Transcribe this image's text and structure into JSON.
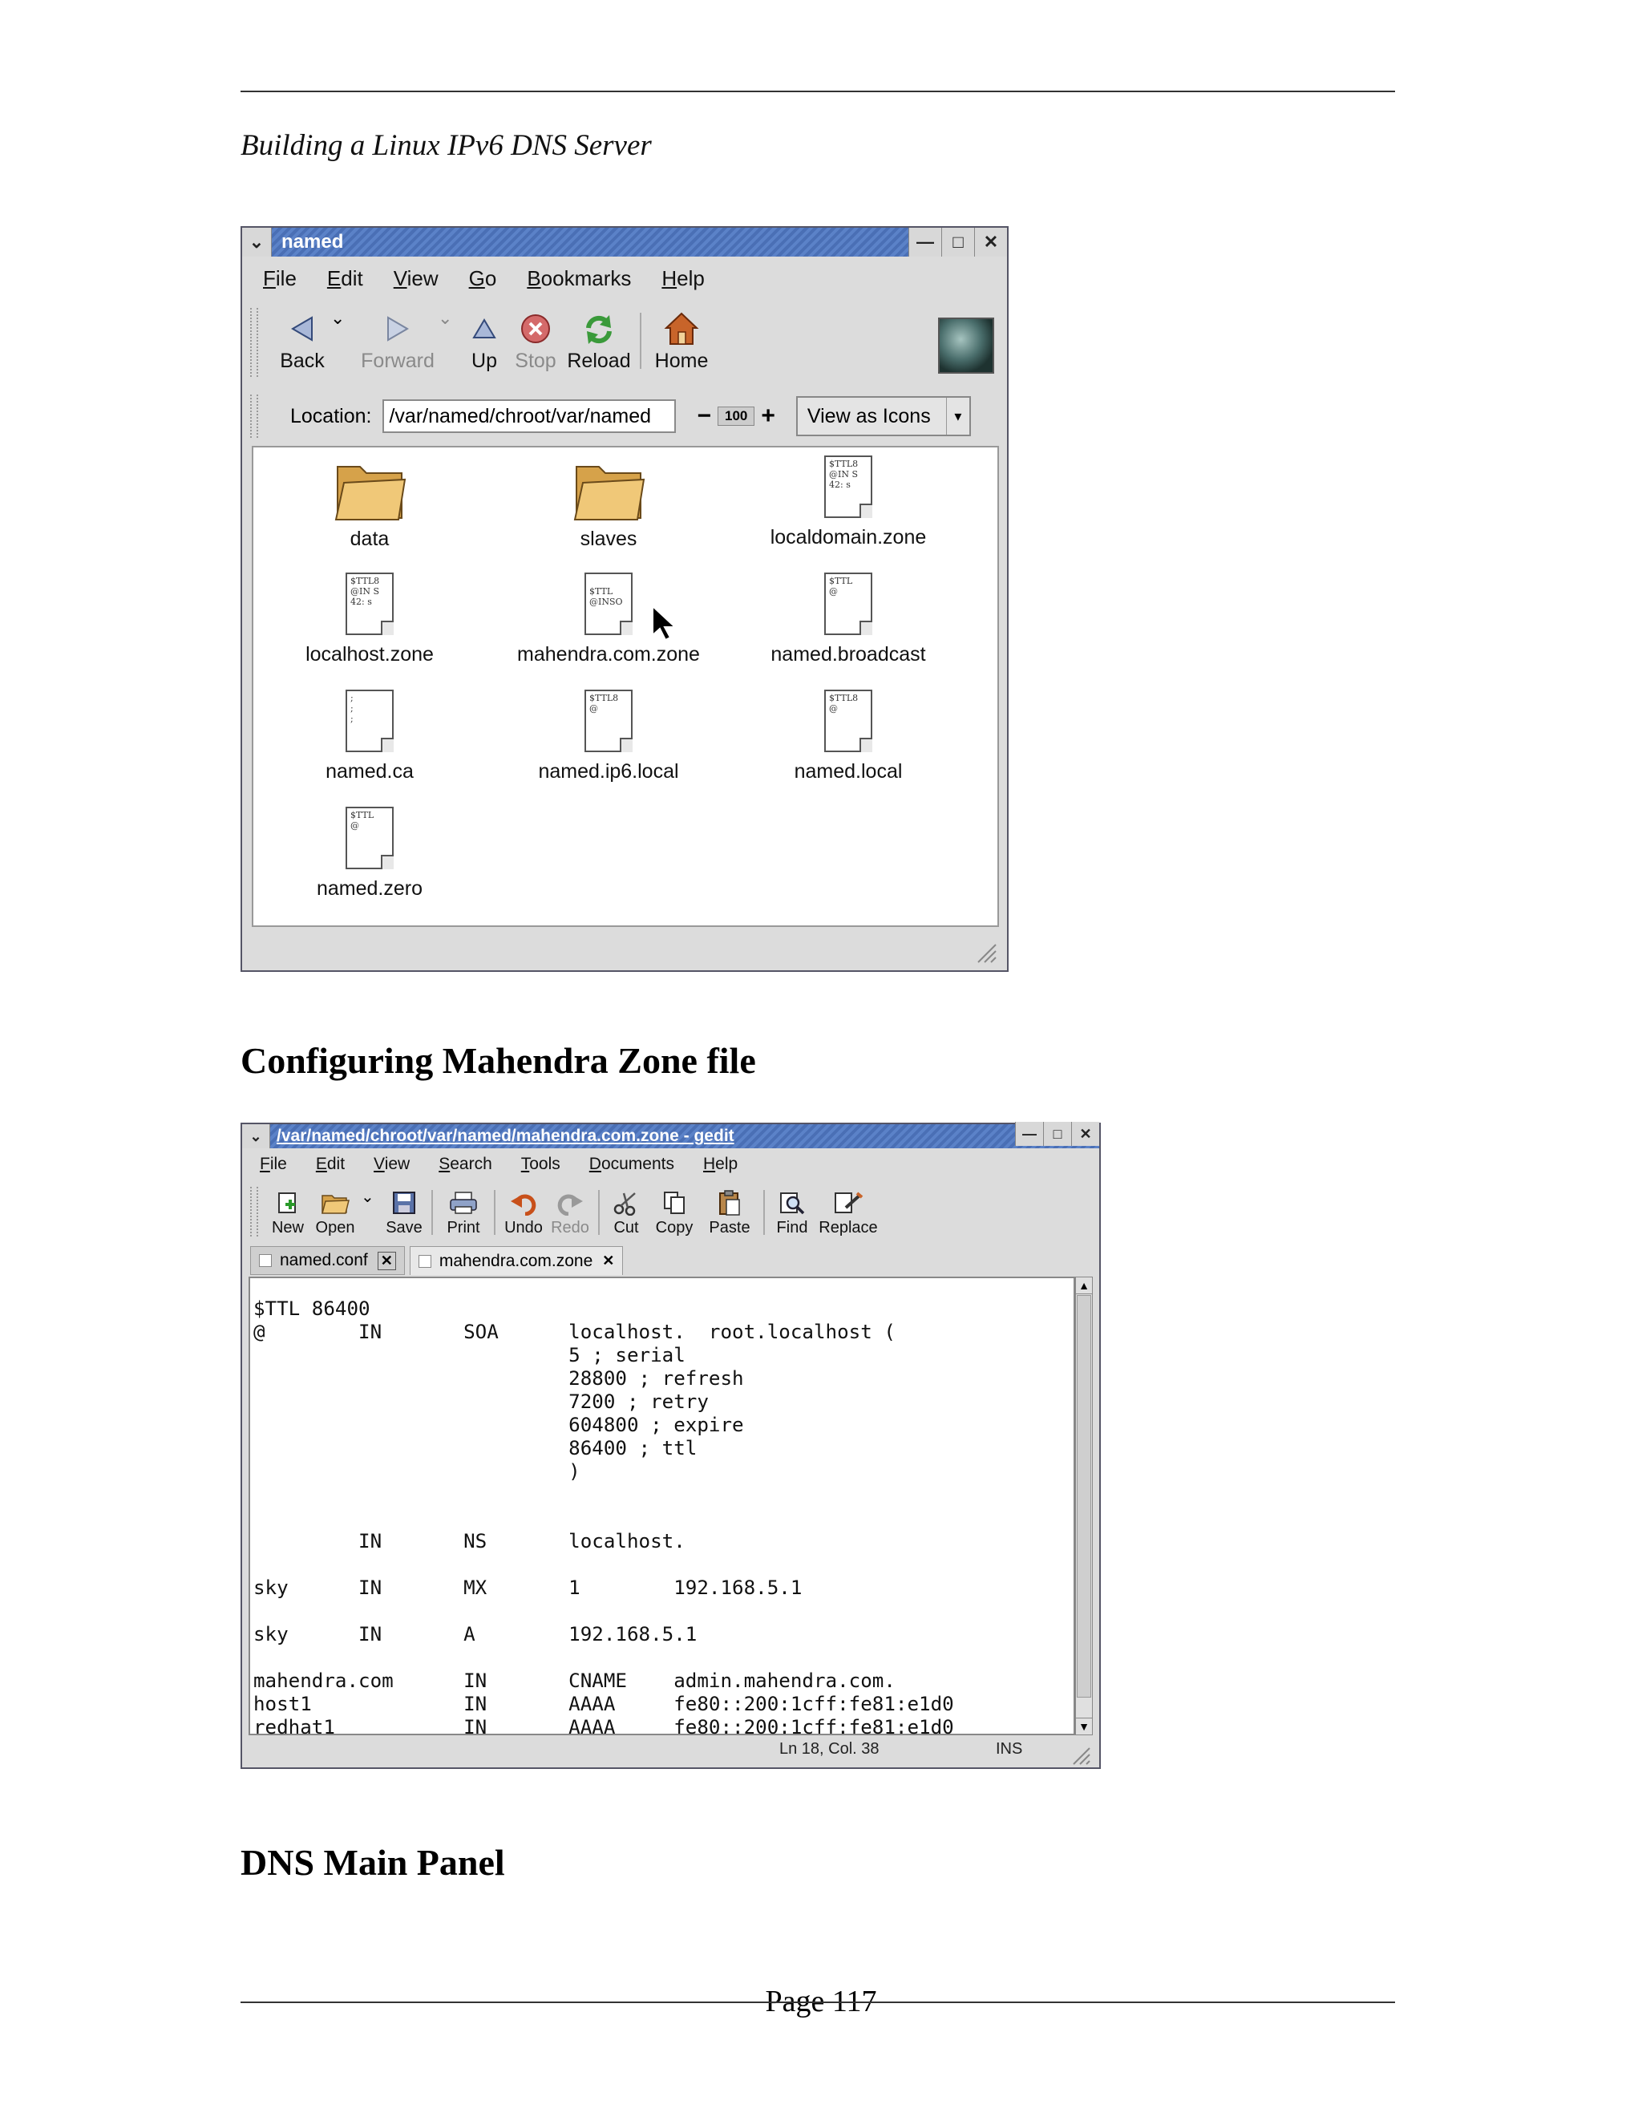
{
  "page": {
    "running_head": "Building a Linux IPv6 DNS Server",
    "heading_zone": "Configuring Mahendra Zone file",
    "heading_panel": "DNS Main Panel",
    "page_number": "Page 117"
  },
  "nautilus": {
    "title": "named",
    "menus": [
      "File",
      "Edit",
      "View",
      "Go",
      "Bookmarks",
      "Help"
    ],
    "toolbar": {
      "back": "Back",
      "forward": "Forward",
      "up": "Up",
      "stop": "Stop",
      "reload": "Reload",
      "home": "Home"
    },
    "location_label": "Location:",
    "location_value": "/var/named/chroot/var/named",
    "zoom": "100",
    "view_as": "View as Icons",
    "files": [
      {
        "name": "data",
        "kind": "folder"
      },
      {
        "name": "slaves",
        "kind": "folder"
      },
      {
        "name": "localdomain.zone",
        "kind": "doc",
        "preview": "$TTL8\n@IN S\n42: s"
      },
      {
        "name": "localhost.zone",
        "kind": "doc",
        "preview": "$TTL8\n@IN S\n42: s"
      },
      {
        "name": "mahendra.com.zone",
        "kind": "doc",
        "preview": "\n$TTL\n@INSO"
      },
      {
        "name": "named.broadcast",
        "kind": "doc",
        "preview": "$TTL\n@"
      },
      {
        "name": "named.ca",
        "kind": "doc",
        "preview": ";\n;\n;"
      },
      {
        "name": "named.ip6.local",
        "kind": "doc",
        "preview": "$TTL8\n@"
      },
      {
        "name": "named.local",
        "kind": "doc",
        "preview": "$TTL8\n@"
      },
      {
        "name": "named.zero",
        "kind": "doc",
        "preview": "$TTL\n@"
      }
    ]
  },
  "gedit": {
    "title": "/var/named/chroot/var/named/mahendra.com.zone - gedit",
    "menus": [
      "File",
      "Edit",
      "View",
      "Search",
      "Tools",
      "Documents",
      "Help"
    ],
    "toolbar": {
      "new": "New",
      "open": "Open",
      "save": "Save",
      "print": "Print",
      "undo": "Undo",
      "redo": "Redo",
      "cut": "Cut",
      "copy": "Copy",
      "paste": "Paste",
      "find": "Find",
      "replace": "Replace"
    },
    "tabs": [
      "named.conf",
      "mahendra.com.zone"
    ],
    "content": "$TTL 86400\n@        IN       SOA      localhost.  root.localhost (\n                           5 ; serial\n                           28800 ; refresh\n                           7200 ; retry\n                           604800 ; expire\n                           86400 ; ttl\n                           )\n\n\n         IN       NS       localhost.\n\nsky      IN       MX       1        192.168.5.1\n\nsky      IN       A        192.168.5.1\n\nmahendra.com      IN       CNAME    admin.mahendra.com.\nhost1             IN       AAAA     fe80::200:1cff:fe81:e1d0\nredhat1           IN       AAAA     fe80::200:1cff:fe81:e1d0",
    "status_position": "Ln 18, Col. 38",
    "status_mode": "INS"
  },
  "icons": {
    "back": "back-arrow-icon",
    "forward": "forward-arrow-icon",
    "up": "up-arrow-icon",
    "stop": "stop-icon",
    "reload": "reload-icon",
    "home": "home-icon",
    "folder": "folder-icon",
    "document": "document-icon"
  }
}
